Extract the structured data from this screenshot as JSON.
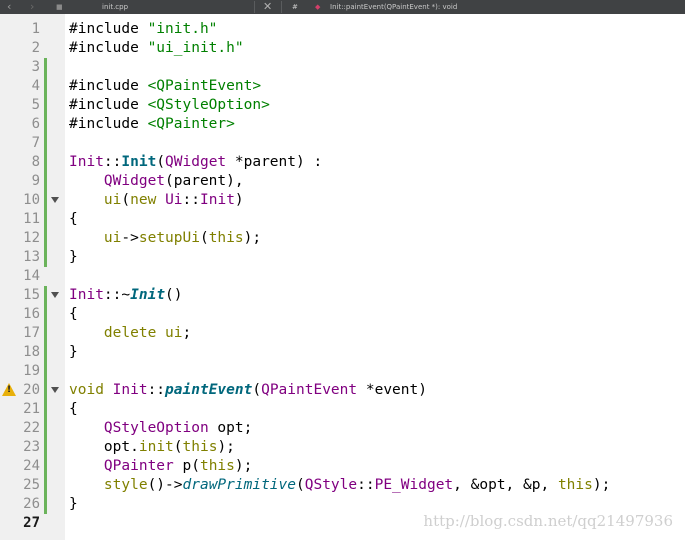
{
  "toolbar": {
    "filename": "init.cpp",
    "symbol": "Init::paintEvent(QPaintEvent *): void",
    "hash": "#"
  },
  "gutter": {
    "current_line": 27,
    "warning_line": 20,
    "fold_lines": [
      10,
      15,
      20
    ],
    "changed_lines": [
      3,
      4,
      5,
      6,
      7,
      8,
      9,
      10,
      11,
      12,
      13,
      15,
      16,
      17,
      18,
      19,
      20,
      21,
      22,
      23,
      24,
      25,
      26
    ]
  },
  "lines": [
    [
      {
        "t": "#include "
      },
      {
        "t": "\"init.h\"",
        "c": "str"
      }
    ],
    [
      {
        "t": "#include "
      },
      {
        "t": "\"ui_init.h\"",
        "c": "str"
      }
    ],
    [],
    [
      {
        "t": "#include "
      },
      {
        "t": "<QPaintEvent>",
        "c": "str"
      }
    ],
    [
      {
        "t": "#include "
      },
      {
        "t": "<QStyleOption>",
        "c": "str"
      }
    ],
    [
      {
        "t": "#include "
      },
      {
        "t": "<QPainter>",
        "c": "str"
      }
    ],
    [],
    [
      {
        "t": "Init",
        "c": "ty"
      },
      {
        "t": "::"
      },
      {
        "t": "Init",
        "c": "fn-def"
      },
      {
        "t": "("
      },
      {
        "t": "QWidget",
        "c": "ty"
      },
      {
        "t": " *parent) :"
      }
    ],
    [
      {
        "t": "    "
      },
      {
        "t": "QWidget",
        "c": "ty"
      },
      {
        "t": "(parent),"
      }
    ],
    [
      {
        "t": "    "
      },
      {
        "t": "ui",
        "c": "kw"
      },
      {
        "t": "("
      },
      {
        "t": "new",
        "c": "kw"
      },
      {
        "t": " "
      },
      {
        "t": "Ui",
        "c": "ty"
      },
      {
        "t": "::"
      },
      {
        "t": "Init",
        "c": "ty"
      },
      {
        "t": ")"
      }
    ],
    [
      {
        "t": "{"
      }
    ],
    [
      {
        "t": "    "
      },
      {
        "t": "ui",
        "c": "kw"
      },
      {
        "t": "->"
      },
      {
        "t": "setupUi",
        "c": "kw"
      },
      {
        "t": "("
      },
      {
        "t": "this",
        "c": "kw"
      },
      {
        "t": ");"
      }
    ],
    [
      {
        "t": "}"
      }
    ],
    [],
    [
      {
        "t": "Init",
        "c": "ty"
      },
      {
        "t": "::~"
      },
      {
        "t": "Init",
        "c": "fn-virt"
      },
      {
        "t": "()"
      }
    ],
    [
      {
        "t": "{"
      }
    ],
    [
      {
        "t": "    "
      },
      {
        "t": "delete",
        "c": "kw"
      },
      {
        "t": " "
      },
      {
        "t": "ui",
        "c": "kw"
      },
      {
        "t": ";"
      }
    ],
    [
      {
        "t": "}"
      }
    ],
    [],
    [
      {
        "t": "void",
        "c": "kw"
      },
      {
        "t": " "
      },
      {
        "t": "Init",
        "c": "ty"
      },
      {
        "t": "::"
      },
      {
        "t": "paintEvent",
        "c": "fn-virt"
      },
      {
        "t": "("
      },
      {
        "t": "QPaintEvent",
        "c": "ty"
      },
      {
        "t": " *event)"
      }
    ],
    [
      {
        "t": "{"
      }
    ],
    [
      {
        "t": "    "
      },
      {
        "t": "QStyleOption",
        "c": "ty"
      },
      {
        "t": " opt;"
      }
    ],
    [
      {
        "t": "    "
      },
      {
        "t": "opt"
      },
      {
        "t": "."
      },
      {
        "t": "init",
        "c": "kw"
      },
      {
        "t": "("
      },
      {
        "t": "this",
        "c": "kw"
      },
      {
        "t": ");"
      }
    ],
    [
      {
        "t": "    "
      },
      {
        "t": "QPainter",
        "c": "ty"
      },
      {
        "t": " p("
      },
      {
        "t": "this",
        "c": "kw"
      },
      {
        "t": ");"
      }
    ],
    [
      {
        "t": "    "
      },
      {
        "t": "style",
        "c": "kw"
      },
      {
        "t": "()->"
      },
      {
        "t": "drawPrimitive",
        "c": "fn-call"
      },
      {
        "t": "("
      },
      {
        "t": "QStyle",
        "c": "ty"
      },
      {
        "t": "::"
      },
      {
        "t": "PE_Widget",
        "c": "en"
      },
      {
        "t": ", &opt, &p, "
      },
      {
        "t": "this",
        "c": "kw"
      },
      {
        "t": ");"
      }
    ],
    [
      {
        "t": "}"
      }
    ],
    []
  ],
  "watermark": "http://blog.csdn.net/qq21497936"
}
